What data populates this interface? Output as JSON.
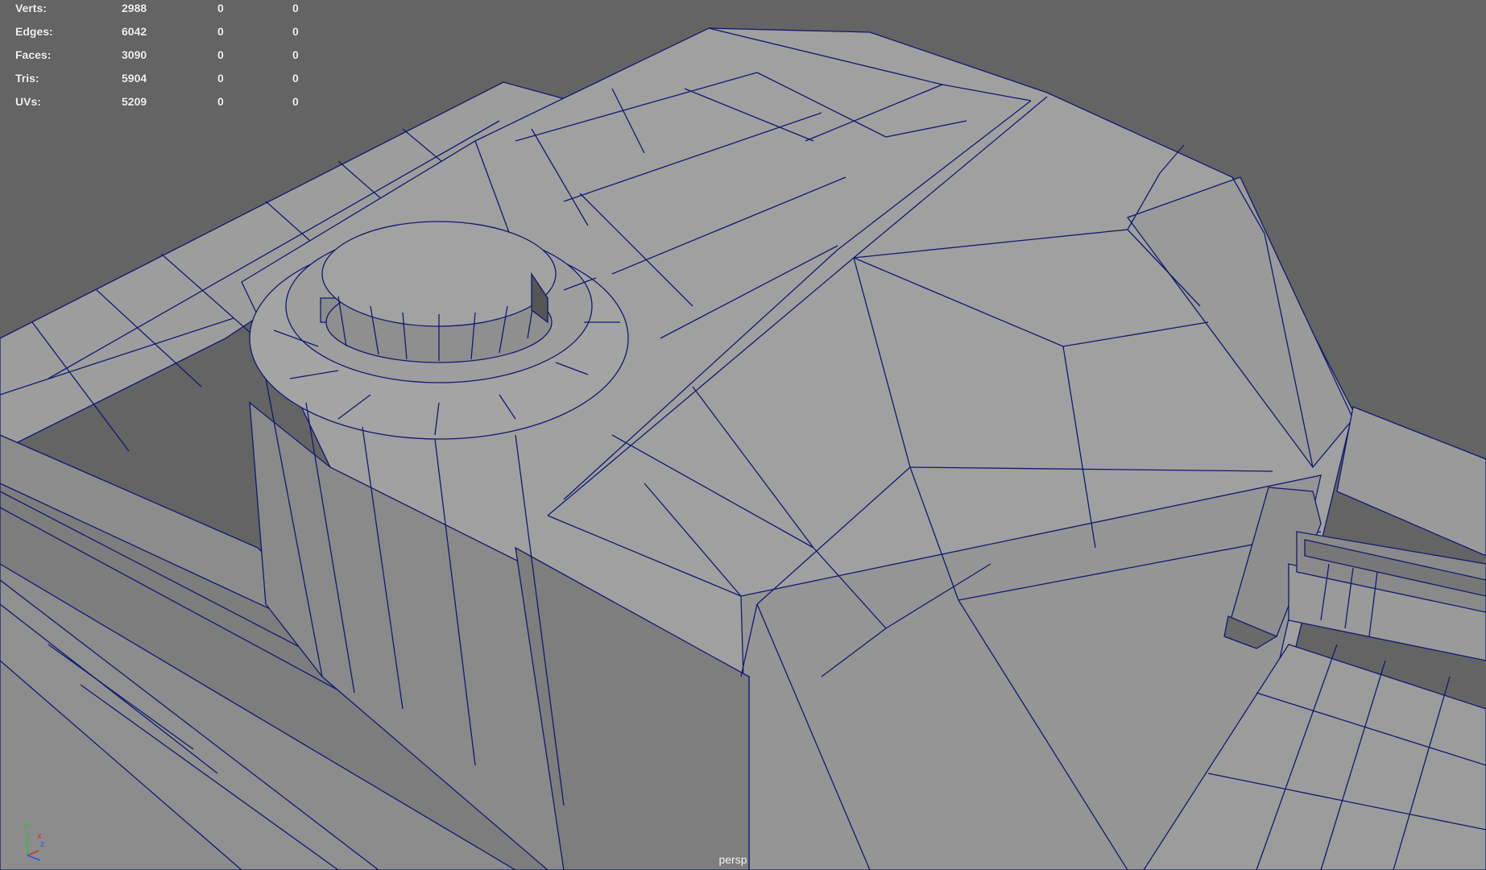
{
  "hud": {
    "rows": [
      {
        "label": "Verts:",
        "v1": "2988",
        "v2": "0",
        "v3": "0"
      },
      {
        "label": "Edges:",
        "v1": "6042",
        "v2": "0",
        "v3": "0"
      },
      {
        "label": "Faces:",
        "v1": "3090",
        "v2": "0",
        "v3": "0"
      },
      {
        "label": "Tris:",
        "v1": "5904",
        "v2": "0",
        "v3": "0"
      },
      {
        "label": "UVs:",
        "v1": "5209",
        "v2": "0",
        "v3": "0"
      }
    ]
  },
  "camera": {
    "name": "persp"
  },
  "axis_gizmo": {
    "x": "x",
    "y": "y",
    "z": "z"
  },
  "colors": {
    "background": "#646464",
    "mesh_face": "#9a9a9a",
    "mesh_face_dark": "#7a7a7a",
    "wireframe": "#0f1a70",
    "axis_x": "#d03030",
    "axis_y": "#30c030",
    "axis_z": "#3050e0"
  }
}
